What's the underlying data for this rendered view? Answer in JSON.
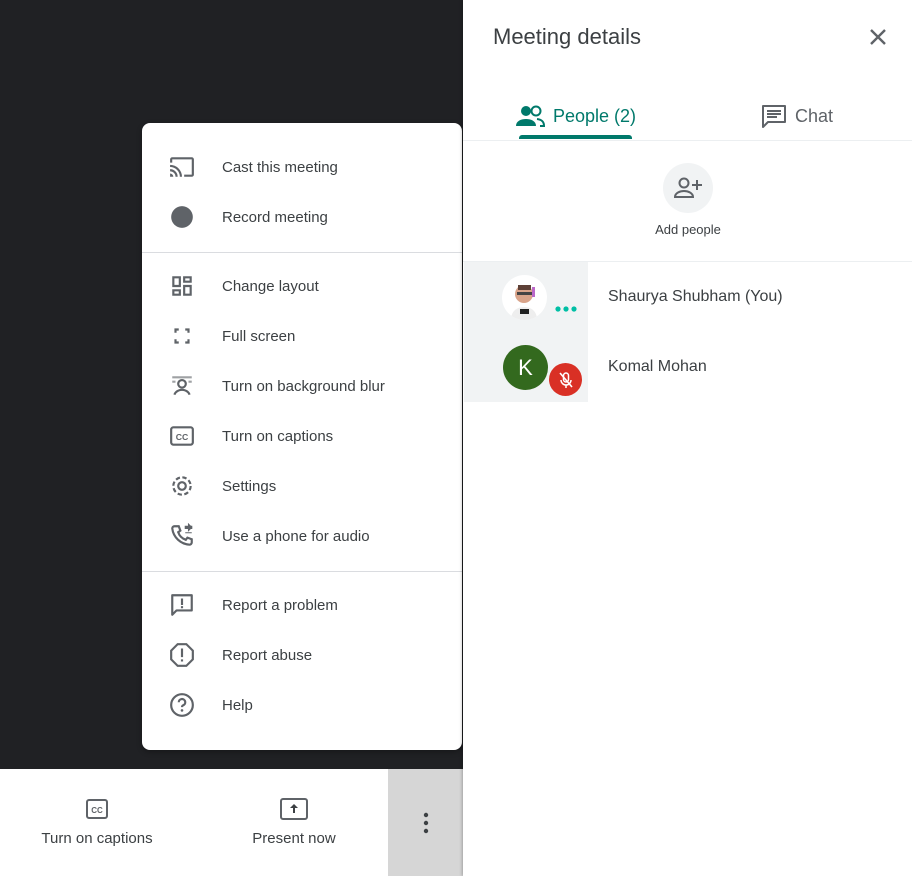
{
  "toolbar": {
    "captions_label": "Turn on captions",
    "present_label": "Present now"
  },
  "menu": {
    "items": [
      {
        "label": "Cast this meeting",
        "icon": "cast-icon"
      },
      {
        "label": "Record meeting",
        "icon": "record-icon"
      },
      {
        "label": "Change layout",
        "icon": "layout-icon"
      },
      {
        "label": "Full screen",
        "icon": "fullscreen-icon"
      },
      {
        "label": "Turn on background blur",
        "icon": "blur-icon"
      },
      {
        "label": "Turn on captions",
        "icon": "captions-icon"
      },
      {
        "label": "Settings",
        "icon": "gear-icon"
      },
      {
        "label": "Use a phone for audio",
        "icon": "phone-icon"
      },
      {
        "label": "Report a problem",
        "icon": "feedback-icon"
      },
      {
        "label": "Report abuse",
        "icon": "report-icon"
      },
      {
        "label": "Help",
        "icon": "help-icon"
      }
    ]
  },
  "panel": {
    "title": "Meeting details",
    "tabs": [
      {
        "label": "People (2)",
        "active": true
      },
      {
        "label": "Chat",
        "active": false
      }
    ],
    "add_people": "Add people",
    "participants": [
      {
        "name": "Shaurya Shubham (You)",
        "initial": ""
      },
      {
        "name": "Komal Mohan",
        "initial": "K",
        "muted": true
      }
    ]
  },
  "colors": {
    "accent": "#00796b",
    "avatar_k": "#33691e",
    "muted": "#d93025"
  }
}
